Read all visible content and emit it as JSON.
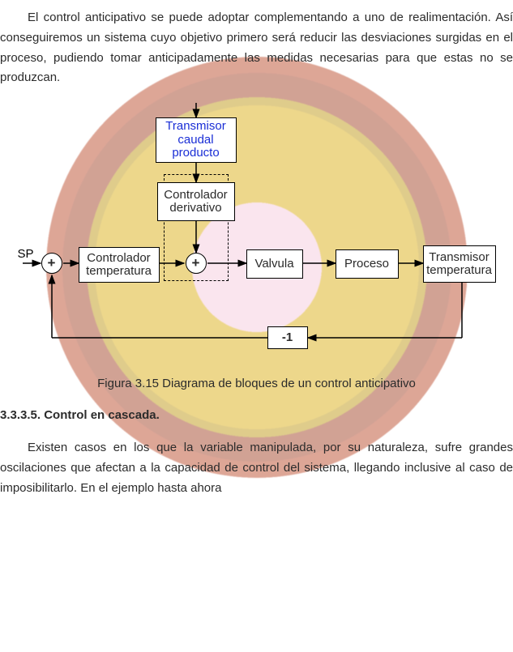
{
  "paragraphs": {
    "p1": "El control anticipativo se puede adoptar complementando a uno de realimentación. Así conseguiremos un sistema cuyo objetivo primero será reducir las desviaciones surgidas en el proceso, pudiendo tomar anticipadamente las medidas necesarias para que estas no se produzcan.",
    "p2": "Existen casos en los que la variable manipulada, por su naturaleza, sufre grandes oscilaciones que afectan a la capacidad de control del sistema, llegando inclusive al caso de imposibilitarlo. En el ejemplo hasta ahora"
  },
  "caption": "Figura 3.15 Diagrama de bloques de un control anticipativo",
  "heading": "3.3.3.5. Control en cascada.",
  "diagram": {
    "sp": "SP",
    "sum_plus": "+",
    "blocks": {
      "trans_caudal": "Transmisor caudal producto",
      "ctrl_deriv": "Controlador derivativo",
      "ctrl_temp": "Controlador temperatura",
      "valvula": "Valvula",
      "proceso": "Proceso",
      "trans_temp": "Transmisor temperatura",
      "neg1": "-1"
    }
  }
}
